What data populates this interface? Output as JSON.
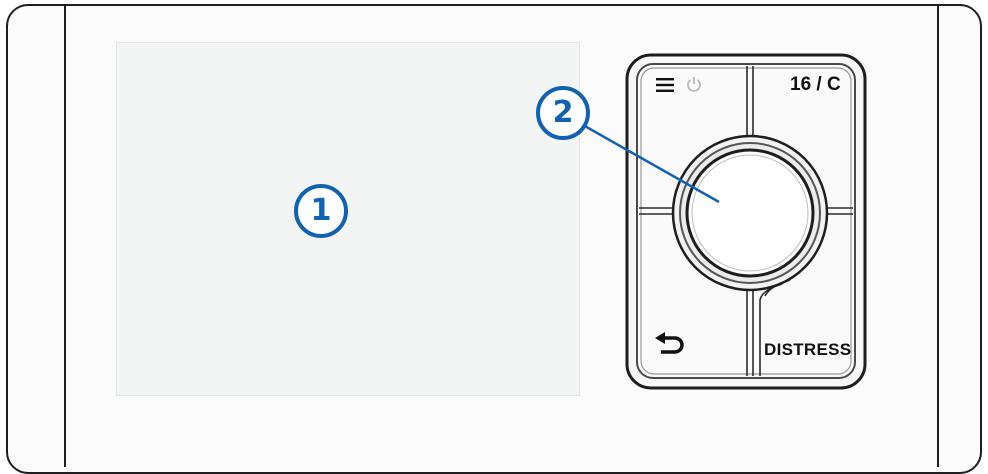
{
  "callouts": {
    "screen_number": "1",
    "knob_number": "2"
  },
  "keypad": {
    "channel_label": "16 / C",
    "distress_label": "DISTRESS",
    "icons": [
      "menu-icon",
      "power-icon",
      "back-icon"
    ]
  },
  "colors": {
    "callout_blue": "#1262b3",
    "outline": "#1e1e1e",
    "screen": "#f3f5f4"
  }
}
